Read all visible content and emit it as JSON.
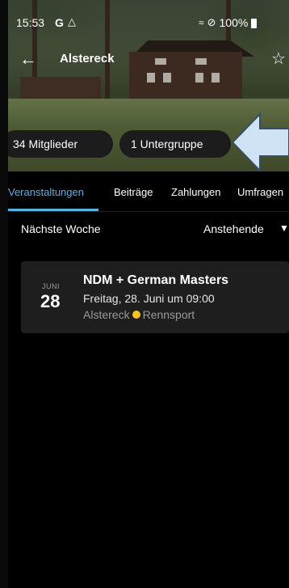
{
  "status_bar": {
    "time": "15:53",
    "g_icon_text": "G",
    "battery": "100%",
    "icons": [
      "google-icon",
      "alert-icon",
      "wifi-icon",
      "dnd-icon",
      "battery-icon"
    ]
  },
  "toolbar": {
    "title": "Alstereck",
    "back_icon": "arrow-left-icon",
    "favorite_icon": "star-outline-icon"
  },
  "chips": {
    "members": "34 Mitglieder",
    "subgroups": "1 Untergruppe"
  },
  "annotation": {
    "arrow_icon": "callout-arrow-icon",
    "arrow_color": "#cfe3f5"
  },
  "tabs": [
    {
      "label": "Veranstaltungen",
      "active": true
    },
    {
      "label": "Beiträge",
      "active": false
    },
    {
      "label": "Zahlungen",
      "active": false
    },
    {
      "label": "Umfragen",
      "active": false
    }
  ],
  "filter": {
    "period": "Nächste Woche",
    "sort": "Anstehende",
    "caret_icon": "triangle-down-icon"
  },
  "events": [
    {
      "month": "JUNI",
      "day": "28",
      "title": "NDM + German Masters",
      "datetime": "Freitag, 28. Juni um 09:00",
      "group": "Alstereck",
      "category": "Rennsport",
      "category_color": "#f5c518"
    }
  ],
  "colors": {
    "accent": "#4fb3e6",
    "background": "#000000",
    "card": "#1e1e1e"
  }
}
